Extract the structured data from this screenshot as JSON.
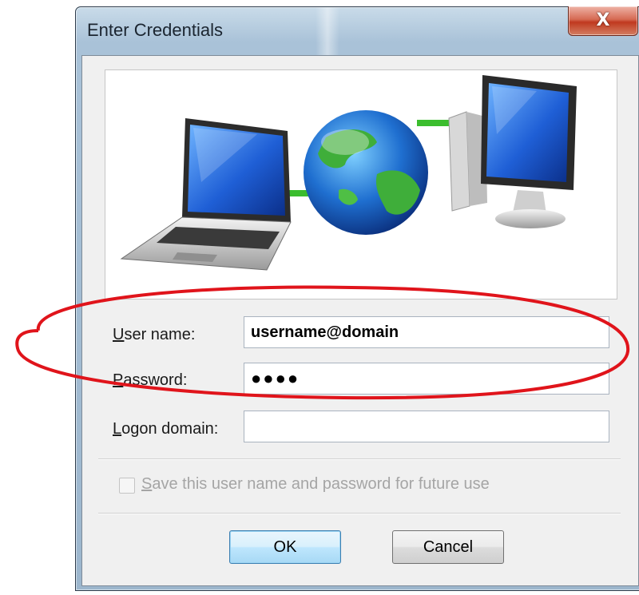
{
  "window": {
    "title": "Enter Credentials",
    "close_glyph": "X"
  },
  "banner": {
    "illustration": [
      "laptop-icon",
      "globe-icon",
      "desktop-computer-icon"
    ]
  },
  "form": {
    "user_name_label": "User name:",
    "user_name_value": "username@domain",
    "password_label": "Password:",
    "password_value": "●●●●",
    "logon_domain_label": "Logon domain:",
    "logon_domain_value": ""
  },
  "save_checkbox": {
    "label": "Save this user name and password for future use",
    "checked": false,
    "enabled": false
  },
  "buttons": {
    "ok": "OK",
    "cancel": "Cancel"
  },
  "colors": {
    "annotation": "#e0141b",
    "default_button_border": "#3c7fb1",
    "close_button": "#c0391f"
  }
}
